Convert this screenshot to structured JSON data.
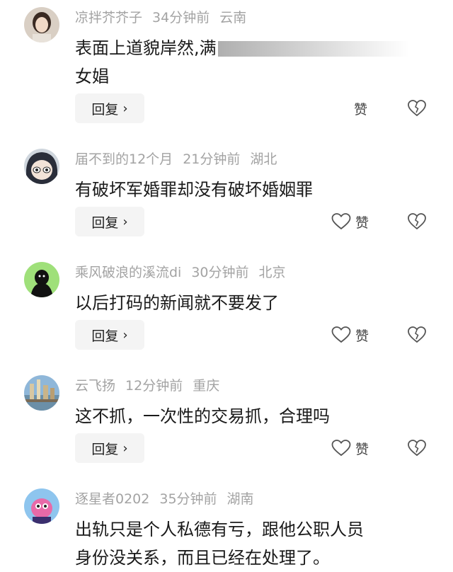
{
  "comments": [
    {
      "username": "凉拌芥芥子",
      "time": "34分钟前",
      "location": "云南",
      "text_line1": "表面上道貌岸然,满",
      "text_line2": "女娼",
      "reply_label": "回复",
      "like_label": "赞",
      "avatar": "woman-photo"
    },
    {
      "username": "届不到的12个月",
      "time": "21分钟前",
      "location": "湖北",
      "text_line1": "有破坏军婚罪却没有破坏婚姻罪",
      "reply_label": "回复",
      "like_label": "赞",
      "avatar": "anime-character"
    },
    {
      "username": "乘风破浪的溪流di",
      "time": "30分钟前",
      "location": "北京",
      "text_line1": "以后打码的新闻就不要发了",
      "reply_label": "回复",
      "like_label": "赞",
      "avatar": "dark-figure"
    },
    {
      "username": "云飞扬",
      "time": "12分钟前",
      "location": "重庆",
      "text_line1": "这不抓，一次性的交易抓，合理吗",
      "reply_label": "回复",
      "like_label": "赞",
      "avatar": "scenery-photo"
    },
    {
      "username": "逐星者0202",
      "time": "35分钟前",
      "location": "湖南",
      "text_line1": "出轨只是个人私德有亏，跟他公职人员",
      "text_line2": "身份没关系，而且已经在处理了。",
      "avatar": "cartoon-pink"
    }
  ],
  "icons": {
    "heart": "heart-icon",
    "broken_heart": "broken-heart-icon",
    "chevron": "›"
  },
  "colors": {
    "meta": "#a3a3a3",
    "text": "#1a1a1a",
    "button_bg": "#f4f4f4"
  }
}
